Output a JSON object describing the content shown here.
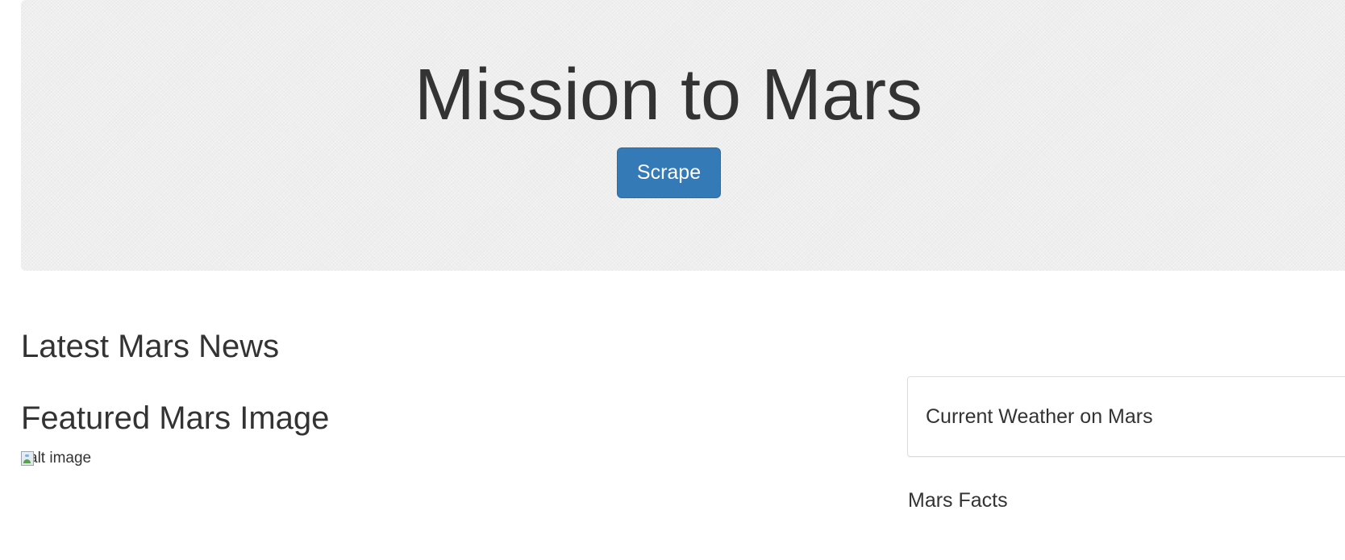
{
  "jumbotron": {
    "title": "Mission to Mars",
    "button_label": "Scrape"
  },
  "news": {
    "heading": "Latest Mars News"
  },
  "featured_image": {
    "heading": "Featured Mars Image",
    "alt_text": "alt image"
  },
  "weather": {
    "heading": "Current Weather on Mars"
  },
  "facts": {
    "heading": "Mars Facts"
  },
  "colors": {
    "primary_button": "#337ab7",
    "jumbotron_bg": "#eeeeee",
    "text": "#333333"
  }
}
